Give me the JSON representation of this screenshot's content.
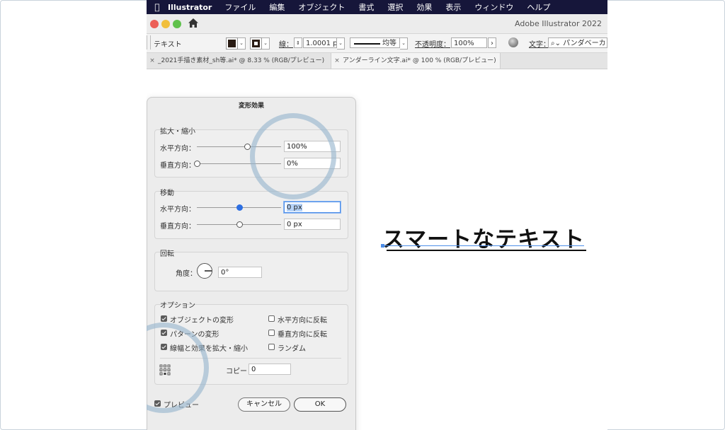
{
  "menubar": {
    "app_name": "Illustrator",
    "items": [
      "ファイル",
      "編集",
      "オブジェクト",
      "書式",
      "選択",
      "効果",
      "表示",
      "ウィンドウ",
      "ヘルプ"
    ]
  },
  "window": {
    "title": "Adobe Illustrator 2022"
  },
  "control_bar": {
    "object_type": "テキスト",
    "stroke_label": "線：",
    "stroke_weight": "1.0001 p",
    "stroke_profile": "均等",
    "opacity_label": "不透明度：",
    "opacity_value": "100%",
    "character_label": "文字：",
    "font_search": "パンダベーカリ"
  },
  "tabs": [
    {
      "label": "_2021手描き素材_sh等.ai* @ 8.33 % (RGB/プレビュー)",
      "close": "×"
    },
    {
      "label": "アンダーライン文字.ai* @ 100 % (RGB/プレビュー)",
      "close": "×"
    }
  ],
  "dialog": {
    "title": "変形効果",
    "scale": {
      "legend": "拡大・縮小",
      "horizontal_label": "水平方向：",
      "horizontal_value": "100%",
      "horizontal_level": 0.6,
      "vertical_label": "垂直方向：",
      "vertical_value": "0%",
      "vertical_level": 0.0
    },
    "move": {
      "legend": "移動",
      "horizontal_label": "水平方向：",
      "horizontal_value": "0 px",
      "horizontal_level": 0.5,
      "vertical_label": "垂直方向：",
      "vertical_value": "0 px",
      "vertical_level": 0.5
    },
    "rotate": {
      "legend": "回転",
      "angle_label": "角度：",
      "angle_value": "0°"
    },
    "options": {
      "legend": "オプション",
      "transform_objects": "オブジェクトの変形",
      "transform_objects_checked": true,
      "transform_patterns": "パターンの変形",
      "transform_patterns_checked": true,
      "scale_strokes": "線幅と効果を拡大・縮小",
      "scale_strokes_checked": true,
      "reflect_x": "水平方向に反転",
      "reflect_x_checked": false,
      "reflect_y": "垂直方向に反転",
      "reflect_y_checked": false,
      "random": "ランダム",
      "random_checked": false,
      "copies_label": "コピー",
      "copies_value": "0"
    },
    "preview_label": "プレビュー",
    "preview_checked": true,
    "cancel_label": "キャンセル",
    "ok_label": "OK"
  },
  "artboard": {
    "text": "スマートなテキスト"
  },
  "colors": {
    "menubar": "#16163a",
    "highlight_ring": "#96b4cd",
    "selection": "#4d8ee8"
  }
}
